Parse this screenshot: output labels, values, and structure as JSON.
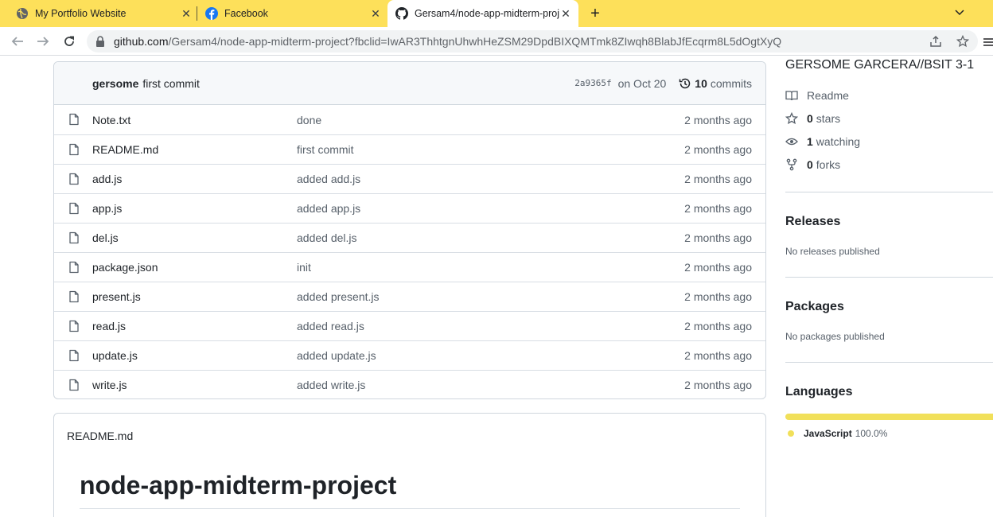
{
  "browser": {
    "tabs": [
      {
        "title": "My Portfolio Website",
        "icon": "globe-icon",
        "active": false
      },
      {
        "title": "Facebook",
        "icon": "facebook-icon",
        "active": false
      },
      {
        "title": "Gersam4/node-app-midterm-project",
        "icon": "github-icon",
        "active": true
      }
    ],
    "url_host": "github.com",
    "url_path": "/Gersam4/node-app-midterm-project?fbclid=IwAR3ThhtgnUhwhHeZSM29DpdBIXQMTmk8ZIwqh8BlabJfEcqrm8L5dOgtXyQ",
    "accent": "#fde05a"
  },
  "repo": {
    "latest_commit": {
      "author": "gersome",
      "message": "first commit",
      "sha": "2a9365f",
      "date": "on Oct 20",
      "count": "10",
      "count_label": "commits"
    },
    "files": [
      {
        "name": "Note.txt",
        "commit": "done",
        "age": "2 months ago"
      },
      {
        "name": "README.md",
        "commit": "first commit",
        "age": "2 months ago"
      },
      {
        "name": "add.js",
        "commit": "added add.js",
        "age": "2 months ago"
      },
      {
        "name": "app.js",
        "commit": "added app.js",
        "age": "2 months ago"
      },
      {
        "name": "del.js",
        "commit": "added del.js",
        "age": "2 months ago"
      },
      {
        "name": "package.json",
        "commit": "init",
        "age": "2 months ago"
      },
      {
        "name": "present.js",
        "commit": "added present.js",
        "age": "2 months ago"
      },
      {
        "name": "read.js",
        "commit": "added read.js",
        "age": "2 months ago"
      },
      {
        "name": "update.js",
        "commit": "added update.js",
        "age": "2 months ago"
      },
      {
        "name": "write.js",
        "commit": "added write.js",
        "age": "2 months ago"
      }
    ],
    "readme": {
      "label": "README.md",
      "title": "node-app-midterm-project"
    }
  },
  "sidebar": {
    "description": "GERSOME GARCERA//BSIT 3-1",
    "readme_label": "Readme",
    "stars": {
      "count": "0",
      "label": "stars"
    },
    "watching": {
      "count": "1",
      "label": "watching"
    },
    "forks": {
      "count": "0",
      "label": "forks"
    },
    "releases": {
      "heading": "Releases",
      "note": "No releases published"
    },
    "packages": {
      "heading": "Packages",
      "note": "No packages published"
    },
    "languages": {
      "heading": "Languages",
      "items": [
        {
          "name": "JavaScript",
          "percent": "100.0%",
          "color": "#f1e05a"
        }
      ]
    }
  }
}
